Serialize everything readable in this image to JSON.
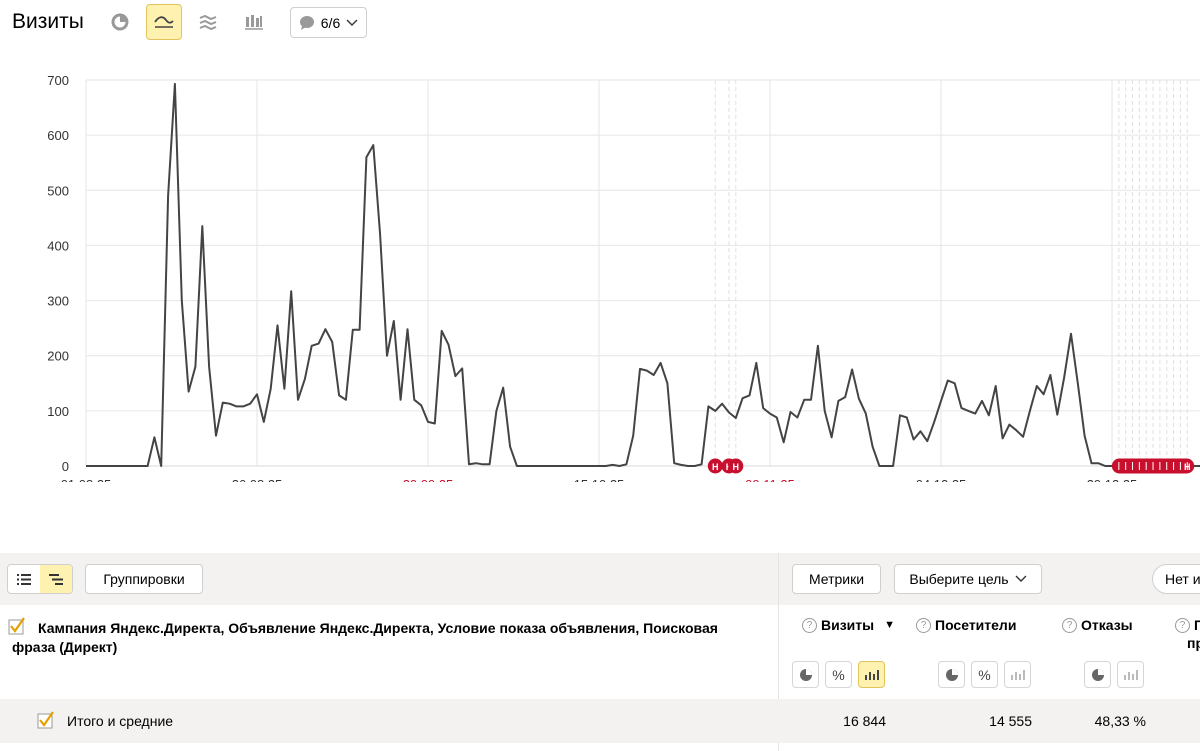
{
  "header": {
    "title": "Визиты",
    "comments_count": "6/6"
  },
  "colors": {
    "accent": "#fff1b0",
    "line": "#444444",
    "holiday_red": "#c8102e"
  },
  "chart_data": {
    "type": "line",
    "ylim": [
      0,
      700
    ],
    "yticks": [
      0,
      100,
      200,
      300,
      400,
      500,
      600,
      700
    ],
    "x_start": "01.08.25",
    "xtick_labels": [
      {
        "label": "01.08.25",
        "day": 0,
        "red": false
      },
      {
        "label": "26.08.25",
        "day": 25,
        "red": false
      },
      {
        "label": "20.09.25",
        "day": 50,
        "red": true
      },
      {
        "label": "15.10.25",
        "day": 75,
        "red": false
      },
      {
        "label": "09.11.25",
        "day": 100,
        "red": true
      },
      {
        "label": "04.12.25",
        "day": 125,
        "red": false
      },
      {
        "label": "29.12.25",
        "day": 150,
        "red": false
      }
    ],
    "holiday_marker_days": [
      92,
      94,
      95
    ],
    "holiday_range_days": [
      151,
      161
    ],
    "holiday_marker_label": "Н",
    "grid": true,
    "series": [
      {
        "values": [
          0,
          0,
          0,
          0,
          0,
          0,
          0,
          0,
          0,
          0,
          52,
          0,
          490,
          693,
          300,
          135,
          180,
          435,
          180,
          55,
          115,
          113,
          108,
          108,
          113,
          130,
          80,
          140,
          255,
          140,
          317,
          120,
          158,
          218,
          222,
          248,
          225,
          128,
          120,
          247,
          247,
          560,
          582,
          420,
          200,
          263,
          120,
          248,
          120,
          110,
          80,
          77,
          245,
          220,
          163,
          177,
          3,
          5,
          3,
          3,
          100,
          142,
          35,
          0,
          0,
          0,
          0,
          0,
          0,
          0,
          0,
          0,
          0,
          0,
          0,
          0,
          0,
          2,
          0,
          3,
          55,
          176,
          173,
          165,
          187,
          150,
          5,
          2,
          0,
          0,
          3,
          108,
          100,
          113,
          97,
          87,
          123,
          128,
          187,
          105,
          95,
          88,
          43,
          98,
          88,
          120,
          120,
          218,
          100,
          52,
          118,
          125,
          175,
          122,
          95,
          35,
          0,
          0,
          0,
          92,
          88,
          48,
          63,
          45,
          80,
          118,
          155,
          150,
          105,
          100,
          95,
          118,
          92,
          145,
          50,
          75,
          65,
          53,
          100,
          145,
          130,
          165,
          93,
          160,
          240,
          150,
          55,
          5,
          5,
          0,
          0,
          0,
          0,
          0,
          0,
          0,
          0,
          0,
          0,
          0,
          0,
          0,
          0,
          0,
          0,
          0
        ]
      }
    ]
  },
  "table": {
    "toolbar": {
      "groupings_label": "Группировки",
      "metrics_label": "Метрики",
      "goal_label": "Выберите цель",
      "right_button_label": "Нет и"
    },
    "dimension_header": "Кампания Яндекс.Директа, Объявление Яндекс.Директа, Условие показа объявления, Поисковая фраза (Директ)",
    "metrics": [
      {
        "label": "Визиты",
        "sort_icon": "▼"
      },
      {
        "label": "Посетители"
      },
      {
        "label": "Отказы"
      },
      {
        "label": "П",
        "label2": "про"
      }
    ],
    "totals": {
      "label": "Итого и средние",
      "visits": "16 844",
      "visitors": "14 555",
      "bounces": "48,33 %"
    }
  }
}
